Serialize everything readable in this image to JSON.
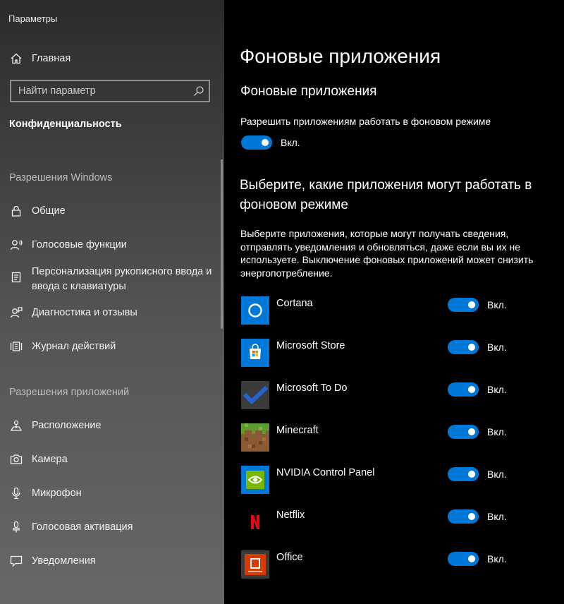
{
  "window": {
    "title": "Параметры"
  },
  "sidebar": {
    "home_label": "Главная",
    "search_placeholder": "Найти параметр",
    "category": "Конфиденциальность",
    "windows_permissions_header": "Разрешения Windows",
    "windows_items": [
      {
        "label": "Общие",
        "icon": "lock-icon"
      },
      {
        "label": "Голосовые функции",
        "icon": "speech-icon"
      },
      {
        "label": "Персонализация рукописного ввода и ввода с клавиатуры",
        "icon": "inking-icon"
      },
      {
        "label": "Диагностика и отзывы",
        "icon": "feedback-icon"
      },
      {
        "label": "Журнал действий",
        "icon": "activity-history-icon"
      }
    ],
    "app_permissions_header": "Разрешения приложений",
    "app_items": [
      {
        "label": "Расположение",
        "icon": "location-icon"
      },
      {
        "label": "Камера",
        "icon": "camera-icon"
      },
      {
        "label": "Микрофон",
        "icon": "microphone-icon"
      },
      {
        "label": "Голосовая активация",
        "icon": "voice-activation-icon"
      },
      {
        "label": "Уведомления",
        "icon": "notifications-icon"
      }
    ]
  },
  "main": {
    "page_title": "Фоновые приложения",
    "section_title": "Фоновые приложения",
    "allow_label": "Разрешить приложениям работать в фоновом режиме",
    "allow_state": "Вкл.",
    "allow_on": true,
    "choose_title": "Выберите, какие приложения могут работать в фоновом режиме",
    "choose_description": "Выберите приложения, которые могут получать сведения, отправлять уведомления и обновляться, даже если вы их не используете. Выключение фоновых приложений может снизить энергопотребление.",
    "apps": [
      {
        "name": "Cortana",
        "state": "Вкл.",
        "on": true,
        "icon": "cortana-icon"
      },
      {
        "name": "Microsoft Store",
        "state": "Вкл.",
        "on": true,
        "icon": "store-icon"
      },
      {
        "name": "Microsoft To Do",
        "state": "Вкл.",
        "on": true,
        "icon": "todo-icon"
      },
      {
        "name": "Minecraft",
        "state": "Вкл.",
        "on": true,
        "icon": "minecraft-icon"
      },
      {
        "name": "NVIDIA Control Panel",
        "state": "Вкл.",
        "on": true,
        "icon": "nvidia-icon"
      },
      {
        "name": "Netflix",
        "state": "Вкл.",
        "on": true,
        "icon": "netflix-icon"
      },
      {
        "name": "Office",
        "state": "Вкл.",
        "on": true,
        "icon": "office-icon"
      }
    ]
  },
  "colors": {
    "accent": "#0078d7",
    "background": "#000000"
  }
}
